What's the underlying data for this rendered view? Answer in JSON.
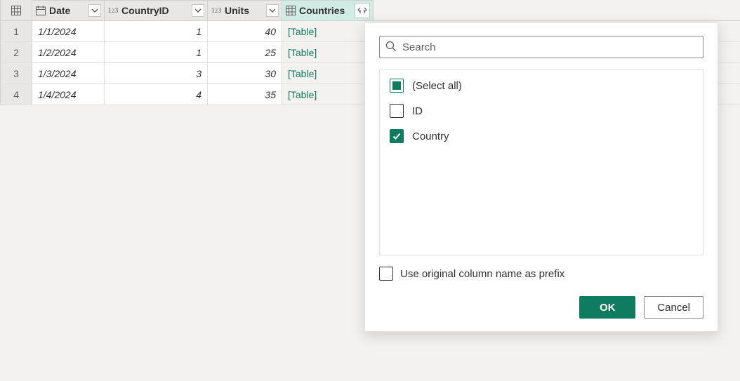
{
  "columns": {
    "date": "Date",
    "countryid": "CountryID",
    "units": "Units",
    "countries": "Countries"
  },
  "rows": [
    {
      "n": "1",
      "date": "1/1/2024",
      "countryid": "1",
      "units": "40",
      "countries": "[Table]"
    },
    {
      "n": "2",
      "date": "1/2/2024",
      "countryid": "1",
      "units": "25",
      "countries": "[Table]"
    },
    {
      "n": "3",
      "date": "1/3/2024",
      "countryid": "3",
      "units": "30",
      "countries": "[Table]"
    },
    {
      "n": "4",
      "date": "1/4/2024",
      "countryid": "4",
      "units": "35",
      "countries": "[Table]"
    }
  ],
  "popup": {
    "search_placeholder": "Search",
    "options": {
      "select_all": "(Select all)",
      "id": "ID",
      "country": "Country"
    },
    "prefix_label": "Use original column name as prefix",
    "ok": "OK",
    "cancel": "Cancel"
  }
}
